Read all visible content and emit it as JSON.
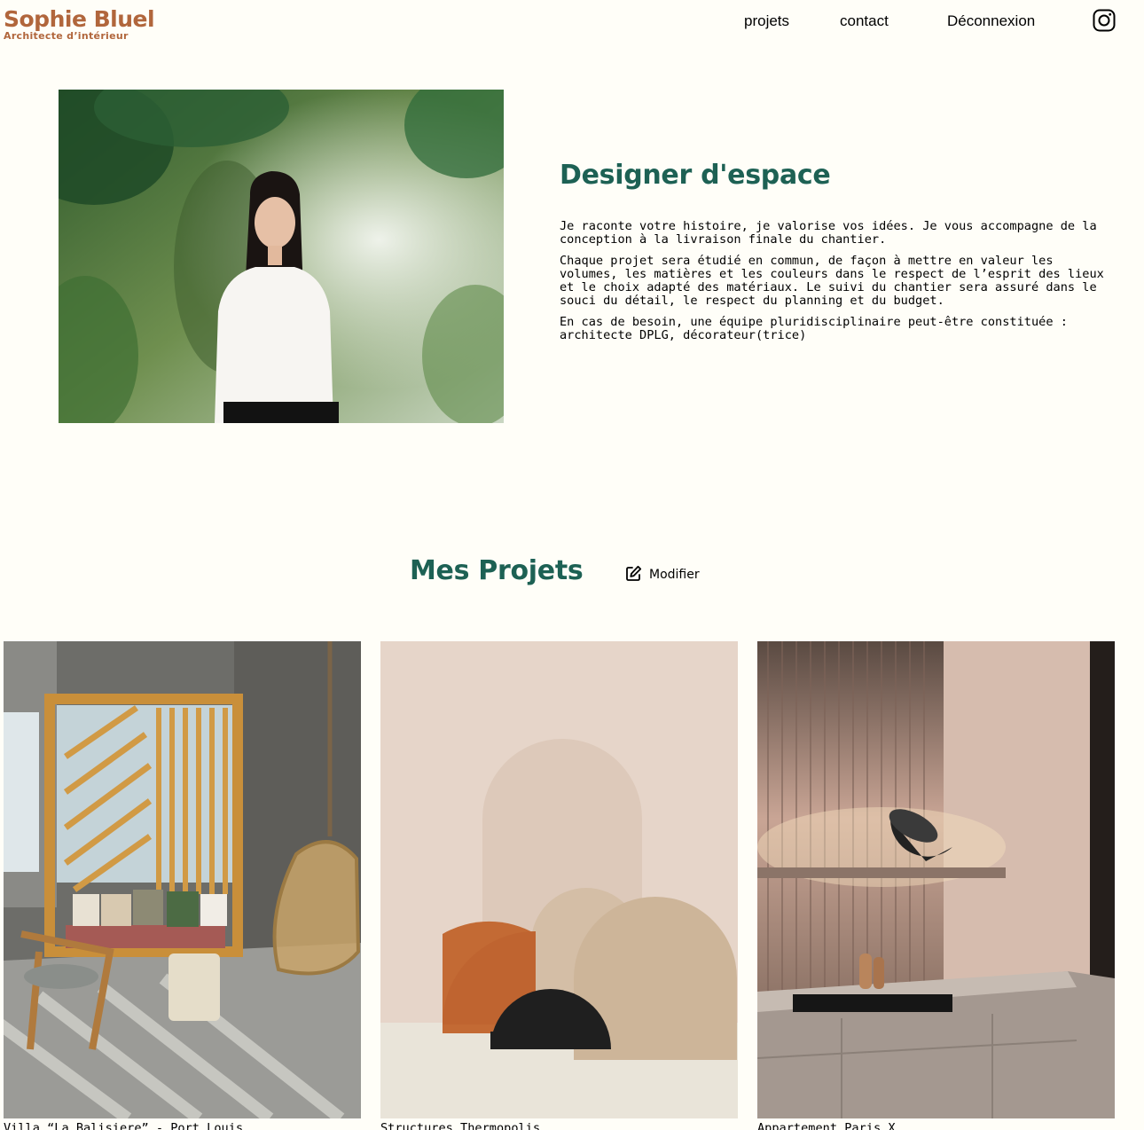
{
  "header": {
    "brand_name": "Sophie Bluel",
    "brand_tagline": "Architecte d’intérieur",
    "nav": [
      {
        "label": "projets"
      },
      {
        "label": "contact"
      },
      {
        "label": "Déconnexion"
      }
    ],
    "social_icon": "instagram-icon"
  },
  "intro": {
    "photo_alt": "Sophie Bluel",
    "title": "Designer d'espace",
    "paragraphs": [
      "Je raconte votre histoire, je valorise vos idées. Je vous accompagne de la conception à la livraison finale du chantier.",
      "Chaque projet sera étudié en commun, de façon à mettre en valeur les volumes, les matières et les couleurs dans le respect de l’esprit des lieux et le choix adapté des matériaux. Le suivi du chantier sera assuré dans le souci du détail, le respect du planning et du budget.",
      "En cas de besoin, une équipe pluridisciplinaire peut-être constituée : architecte DPLG, décorateur(trice)"
    ]
  },
  "projects": {
    "title": "Mes Projets",
    "edit_label": "Modifier",
    "edit_icon": "edit-icon",
    "items": [
      {
        "caption": "Villa “La Balisiere” - Port Louis"
      },
      {
        "caption": "Structures Thermopolis"
      },
      {
        "caption": "Appartement Paris X"
      }
    ]
  },
  "colors": {
    "background": "#FFFEF8",
    "brand": "#B1663C",
    "accent": "#1D6154"
  }
}
